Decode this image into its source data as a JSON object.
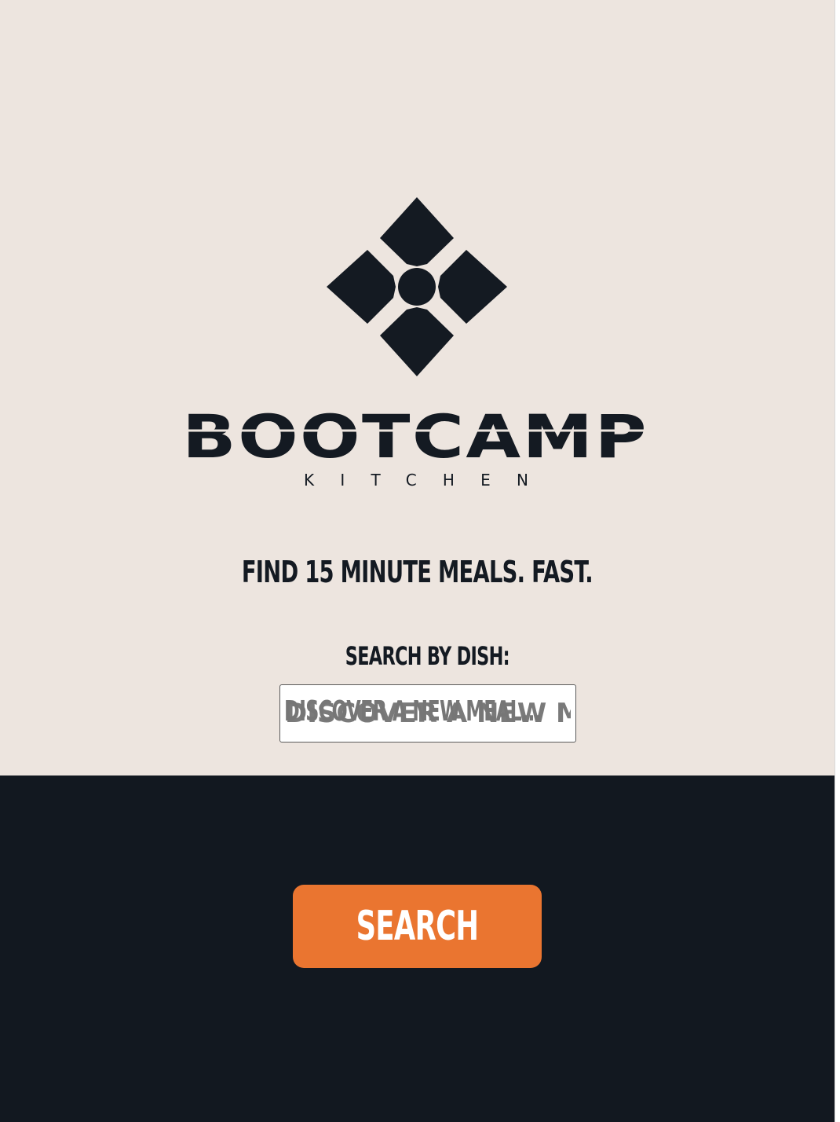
{
  "logo": {
    "brand": "BOOTCAMP",
    "sub": "KITCHEN",
    "icon": "diamond-flower-icon"
  },
  "headline": "FIND 15 MINUTE MEALS. FAST.",
  "search": {
    "label": "SEARCH BY DISH:",
    "placeholder": "DISCOVER A NEW MEAL...",
    "value": "",
    "button_label": "SEARCH"
  },
  "colors": {
    "top_background": "#ede5df",
    "bottom_background": "#121820",
    "accent": "#ea7530",
    "text_dark": "#141a22"
  }
}
